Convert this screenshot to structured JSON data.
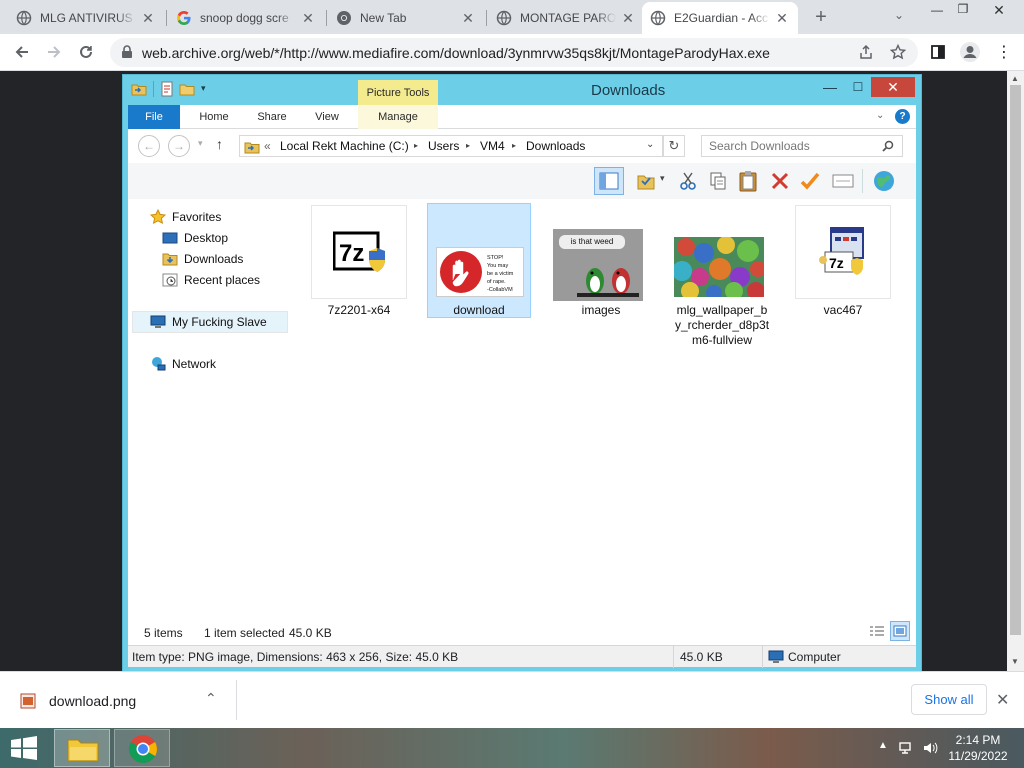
{
  "browser": {
    "tabs": [
      {
        "title": "MLG ANTIVIRUS",
        "active": false,
        "favicon": "globe-icon"
      },
      {
        "title": "snoop dogg scre",
        "active": false,
        "favicon": "google-icon"
      },
      {
        "title": "New Tab",
        "active": false,
        "favicon": "chrome-icon"
      },
      {
        "title": "MONTAGE PARO",
        "active": false,
        "favicon": "globe-icon"
      },
      {
        "title": "E2Guardian - Acc",
        "active": true,
        "favicon": "globe-icon"
      }
    ],
    "url": "web.archive.org/web/*/http://www.mediafire.com/download/3ynmrvw35qs8kjt/MontageParodyHax.exe"
  },
  "explorer": {
    "window_title": "Downloads",
    "contextual_tab": "Picture Tools",
    "ribbon_tabs": [
      "File",
      "Home",
      "Share",
      "View",
      "Manage"
    ],
    "breadcrumb": [
      "Local Rekt Machine (C:)",
      "Users",
      "VM4",
      "Downloads"
    ],
    "breadcrumb_prefix": "«",
    "search_placeholder": "Search Downloads",
    "nav": {
      "favorites": "Favorites",
      "desktop": "Desktop",
      "downloads": "Downloads",
      "recent": "Recent places",
      "computer": "My Fucking Slave",
      "network": "Network"
    },
    "files": [
      {
        "name": "7z2201-x64",
        "selected": false
      },
      {
        "name": "download",
        "selected": true,
        "thumb_text": [
          "STOP!",
          "You may",
          "be a victim",
          "of rape.",
          "-CollabVM"
        ]
      },
      {
        "name": "images",
        "selected": false,
        "thumb_text": "is that weed"
      },
      {
        "name": "mlg_wallpaper_by_rcherder_d8p3tm6-fullview",
        "selected": false
      },
      {
        "name": "vac467",
        "selected": false
      }
    ],
    "status": {
      "items": "5 items",
      "selected": "1 item selected",
      "size": "45.0 KB"
    },
    "details": {
      "info": "Item type: PNG image, Dimensions: 463 x 256, Size: 45.0 KB",
      "size": "45.0 KB",
      "location": "Computer"
    }
  },
  "download_shelf": {
    "file": "download.png",
    "show_all": "Show all"
  },
  "taskbar": {
    "time": "2:14 PM",
    "date": "11/29/2022"
  }
}
